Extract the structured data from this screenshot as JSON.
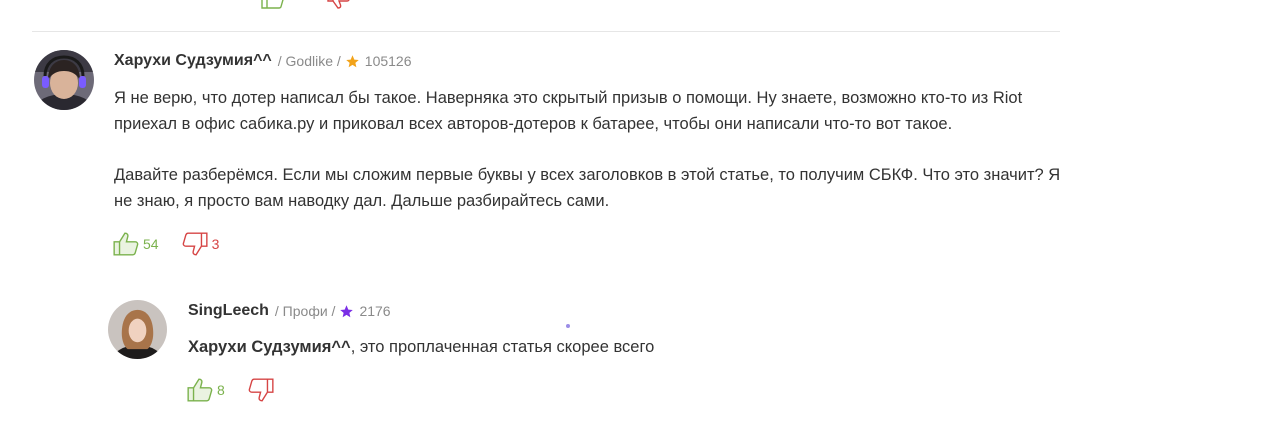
{
  "comments": [
    {
      "author": "Харухи Судзумия^^",
      "rank": "/ Godlike /",
      "rating": "105126",
      "star_color": "#f2a31a",
      "paragraphs": [
        "Я не верю, что дотер написал бы такое. Наверняка это скрытый призыв о помощи. Ну знаете, возможно кто-то из Riot приехал в офис сабика.ру и приковал всех авторов-дотеров к батарее, чтобы они написали что-то вот такое.",
        "Давайте разберёмся. Если мы сложим первые буквы у всех заголовков в этой статье, то получим СБКФ. Что это значит? Я не знаю, я просто вам наводку дал. Дальше разбирайтесь сами."
      ],
      "likes": "54",
      "dislikes": "3"
    },
    {
      "author": "SingLeech",
      "rank": "/ Профи /",
      "rating": "2176",
      "star_color": "#7b2ee6",
      "mention": "Харухи Судзумия^^",
      "text": ", это проплаченная статья скорее всего",
      "likes": "8",
      "dislikes": ""
    }
  ],
  "colors": {
    "like": "#7bb24d",
    "dislike": "#d64545"
  },
  "icons": [
    "thumbs-up-icon",
    "thumbs-down-icon",
    "star-icon"
  ]
}
